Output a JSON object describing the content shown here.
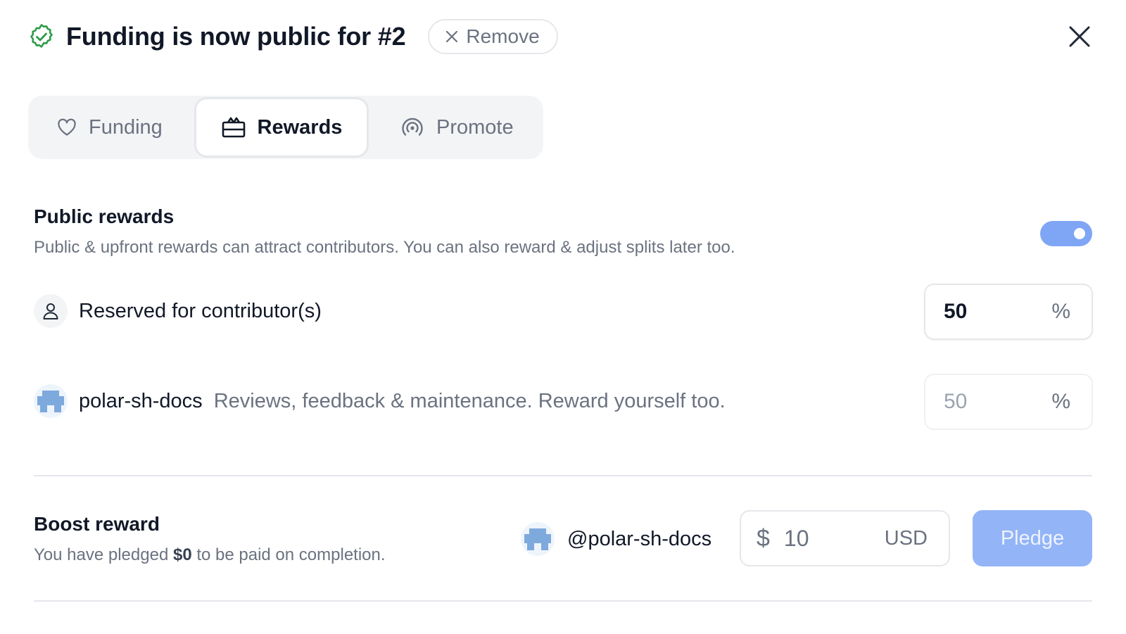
{
  "header": {
    "title": "Funding is now public for #2",
    "remove_label": "Remove"
  },
  "tabs": [
    {
      "label": "Funding",
      "icon": "heart-icon",
      "active": false
    },
    {
      "label": "Rewards",
      "icon": "gift-icon",
      "active": true
    },
    {
      "label": "Promote",
      "icon": "broadcast-icon",
      "active": false
    }
  ],
  "public_rewards": {
    "title": "Public rewards",
    "description": "Public & upfront rewards can attract contributors. You can also reward & adjust splits later too.",
    "toggle_on": true
  },
  "splits": [
    {
      "label": "Reserved for contributor(s)",
      "subtext": "",
      "value": "50",
      "unit": "%"
    },
    {
      "label": "polar-sh-docs",
      "subtext": "Reviews, feedback & maintenance. Reward yourself too.",
      "value": "50",
      "unit": "%"
    }
  ],
  "boost": {
    "title": "Boost reward",
    "desc_prefix": "You have pledged",
    "pledged_amount": "$0",
    "desc_suffix": "to be paid on completion.",
    "handle": "@polar-sh-docs",
    "currency_symbol": "$",
    "amount": "10",
    "currency": "USD",
    "pledge_label": "Pledge"
  },
  "colors": {
    "accent": "#7fa5f5",
    "pledge_button": "#93b4f7",
    "success": "#2e9b4a",
    "muted_text": "#6b7280"
  }
}
